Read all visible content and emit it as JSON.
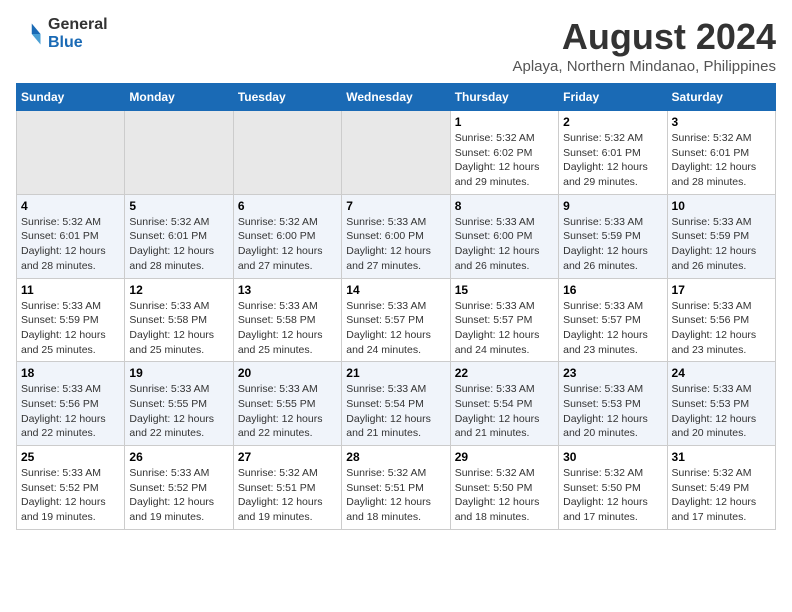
{
  "header": {
    "logo_line1": "General",
    "logo_line2": "Blue",
    "title": "August 2024",
    "subtitle": "Aplaya, Northern Mindanao, Philippines"
  },
  "calendar": {
    "days_of_week": [
      "Sunday",
      "Monday",
      "Tuesday",
      "Wednesday",
      "Thursday",
      "Friday",
      "Saturday"
    ],
    "weeks": [
      [
        {
          "day": "",
          "info": ""
        },
        {
          "day": "",
          "info": ""
        },
        {
          "day": "",
          "info": ""
        },
        {
          "day": "",
          "info": ""
        },
        {
          "day": "1",
          "info": "Sunrise: 5:32 AM\nSunset: 6:02 PM\nDaylight: 12 hours\nand 29 minutes."
        },
        {
          "day": "2",
          "info": "Sunrise: 5:32 AM\nSunset: 6:01 PM\nDaylight: 12 hours\nand 29 minutes."
        },
        {
          "day": "3",
          "info": "Sunrise: 5:32 AM\nSunset: 6:01 PM\nDaylight: 12 hours\nand 28 minutes."
        }
      ],
      [
        {
          "day": "4",
          "info": "Sunrise: 5:32 AM\nSunset: 6:01 PM\nDaylight: 12 hours\nand 28 minutes."
        },
        {
          "day": "5",
          "info": "Sunrise: 5:32 AM\nSunset: 6:01 PM\nDaylight: 12 hours\nand 28 minutes."
        },
        {
          "day": "6",
          "info": "Sunrise: 5:32 AM\nSunset: 6:00 PM\nDaylight: 12 hours\nand 27 minutes."
        },
        {
          "day": "7",
          "info": "Sunrise: 5:33 AM\nSunset: 6:00 PM\nDaylight: 12 hours\nand 27 minutes."
        },
        {
          "day": "8",
          "info": "Sunrise: 5:33 AM\nSunset: 6:00 PM\nDaylight: 12 hours\nand 26 minutes."
        },
        {
          "day": "9",
          "info": "Sunrise: 5:33 AM\nSunset: 5:59 PM\nDaylight: 12 hours\nand 26 minutes."
        },
        {
          "day": "10",
          "info": "Sunrise: 5:33 AM\nSunset: 5:59 PM\nDaylight: 12 hours\nand 26 minutes."
        }
      ],
      [
        {
          "day": "11",
          "info": "Sunrise: 5:33 AM\nSunset: 5:59 PM\nDaylight: 12 hours\nand 25 minutes."
        },
        {
          "day": "12",
          "info": "Sunrise: 5:33 AM\nSunset: 5:58 PM\nDaylight: 12 hours\nand 25 minutes."
        },
        {
          "day": "13",
          "info": "Sunrise: 5:33 AM\nSunset: 5:58 PM\nDaylight: 12 hours\nand 25 minutes."
        },
        {
          "day": "14",
          "info": "Sunrise: 5:33 AM\nSunset: 5:57 PM\nDaylight: 12 hours\nand 24 minutes."
        },
        {
          "day": "15",
          "info": "Sunrise: 5:33 AM\nSunset: 5:57 PM\nDaylight: 12 hours\nand 24 minutes."
        },
        {
          "day": "16",
          "info": "Sunrise: 5:33 AM\nSunset: 5:57 PM\nDaylight: 12 hours\nand 23 minutes."
        },
        {
          "day": "17",
          "info": "Sunrise: 5:33 AM\nSunset: 5:56 PM\nDaylight: 12 hours\nand 23 minutes."
        }
      ],
      [
        {
          "day": "18",
          "info": "Sunrise: 5:33 AM\nSunset: 5:56 PM\nDaylight: 12 hours\nand 22 minutes."
        },
        {
          "day": "19",
          "info": "Sunrise: 5:33 AM\nSunset: 5:55 PM\nDaylight: 12 hours\nand 22 minutes."
        },
        {
          "day": "20",
          "info": "Sunrise: 5:33 AM\nSunset: 5:55 PM\nDaylight: 12 hours\nand 22 minutes."
        },
        {
          "day": "21",
          "info": "Sunrise: 5:33 AM\nSunset: 5:54 PM\nDaylight: 12 hours\nand 21 minutes."
        },
        {
          "day": "22",
          "info": "Sunrise: 5:33 AM\nSunset: 5:54 PM\nDaylight: 12 hours\nand 21 minutes."
        },
        {
          "day": "23",
          "info": "Sunrise: 5:33 AM\nSunset: 5:53 PM\nDaylight: 12 hours\nand 20 minutes."
        },
        {
          "day": "24",
          "info": "Sunrise: 5:33 AM\nSunset: 5:53 PM\nDaylight: 12 hours\nand 20 minutes."
        }
      ],
      [
        {
          "day": "25",
          "info": "Sunrise: 5:33 AM\nSunset: 5:52 PM\nDaylight: 12 hours\nand 19 minutes."
        },
        {
          "day": "26",
          "info": "Sunrise: 5:33 AM\nSunset: 5:52 PM\nDaylight: 12 hours\nand 19 minutes."
        },
        {
          "day": "27",
          "info": "Sunrise: 5:32 AM\nSunset: 5:51 PM\nDaylight: 12 hours\nand 19 minutes."
        },
        {
          "day": "28",
          "info": "Sunrise: 5:32 AM\nSunset: 5:51 PM\nDaylight: 12 hours\nand 18 minutes."
        },
        {
          "day": "29",
          "info": "Sunrise: 5:32 AM\nSunset: 5:50 PM\nDaylight: 12 hours\nand 18 minutes."
        },
        {
          "day": "30",
          "info": "Sunrise: 5:32 AM\nSunset: 5:50 PM\nDaylight: 12 hours\nand 17 minutes."
        },
        {
          "day": "31",
          "info": "Sunrise: 5:32 AM\nSunset: 5:49 PM\nDaylight: 12 hours\nand 17 minutes."
        }
      ]
    ]
  }
}
